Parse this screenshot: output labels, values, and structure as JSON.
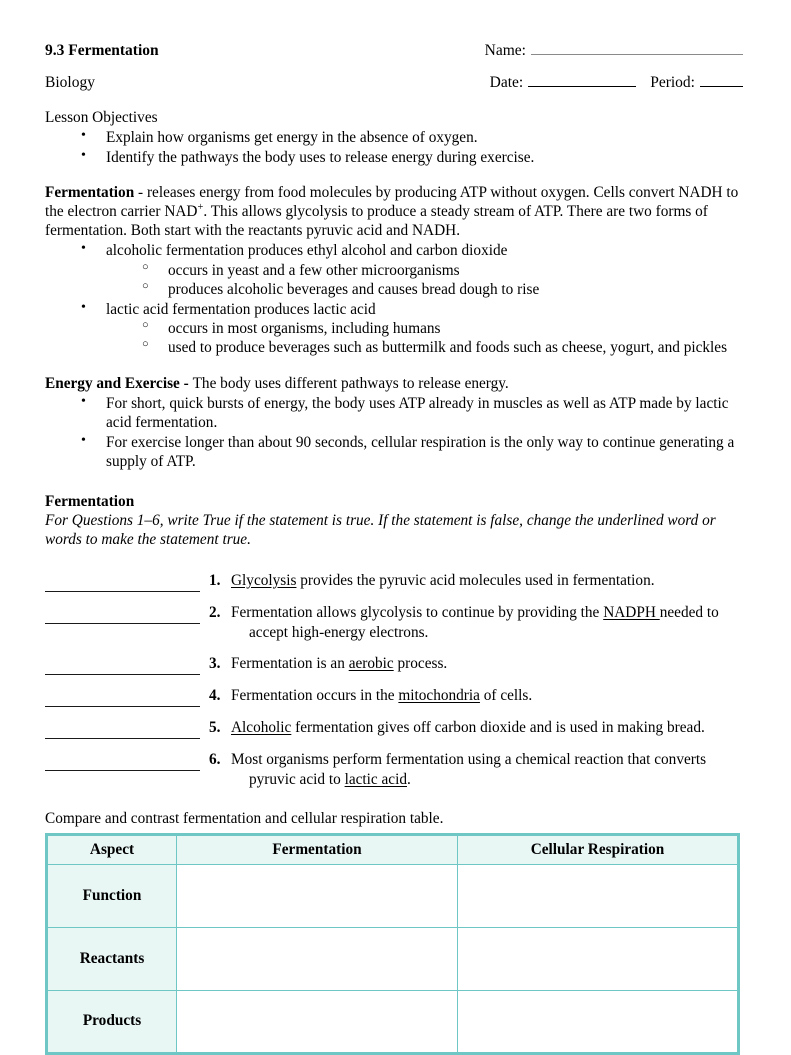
{
  "header": {
    "title": "9.3 Fermentation",
    "subject": "Biology",
    "name_label": "Name:",
    "date_label": "Date:",
    "period_label": "Period:"
  },
  "objectives": {
    "heading": "Lesson Objectives",
    "items": [
      "Explain how organisms get energy in the absence of oxygen.",
      "Identify the pathways the body uses to release energy during exercise."
    ]
  },
  "fermentation_section": {
    "term": "Fermentation",
    "definition_part1": " - releases energy from food molecules by producing ATP without oxygen. Cells convert NADH to the electron carrier NAD",
    "superscript": "+",
    "definition_part2": ". This allows glycolysis to produce a steady stream of ATP. There are two forms of fermentation. Both start with the reactants pyruvic acid and NADH.",
    "types": [
      {
        "label": "alcoholic fermentation produces ethyl alcohol and carbon dioxide",
        "subitems": [
          "occurs in yeast and a few other microorganisms",
          "produces alcoholic beverages and causes bread dough to rise"
        ]
      },
      {
        "label": "lactic acid fermentation produces lactic acid",
        "subitems": [
          "occurs in most organisms, including humans",
          "used to produce beverages such as buttermilk and foods such as cheese, yogurt, and pickles"
        ]
      }
    ]
  },
  "energy_section": {
    "term": "Energy and Exercise - ",
    "intro": "The body uses different pathways to release energy.",
    "items": [
      "For short, quick bursts of energy, the body uses ATP already in muscles as well as ATP made by lactic acid fermentation.",
      "For exercise longer than about 90 seconds, cellular respiration is the only way to continue generating a supply of ATP."
    ]
  },
  "questions_section": {
    "heading": "Fermentation",
    "instructions": "For Questions 1–6, write True if the statement is true. If the statement is false, change the underlined word or words to make the statement true.",
    "items": [
      {
        "number": "1.",
        "pre": "",
        "underlined": "Glycolysis",
        "post": " provides the pyruvic acid molecules used in fermentation.",
        "continuation": ""
      },
      {
        "number": "2.",
        "pre": "Fermentation allows glycolysis to continue by providing the ",
        "underlined": "NADPH ",
        "post": "needed to",
        "continuation": "accept high-energy electrons."
      },
      {
        "number": "3.",
        "pre": "Fermentation is an ",
        "underlined": "aerobic",
        "post": " process.",
        "continuation": ""
      },
      {
        "number": "4.",
        "pre": "Fermentation occurs in the ",
        "underlined": "mitochondria",
        "post": " of cells.",
        "continuation": ""
      },
      {
        "number": "5.",
        "pre": "",
        "underlined": "Alcoholic",
        "post": " fermentation gives off carbon dioxide and is used in making bread.",
        "continuation": ""
      },
      {
        "number": "6.",
        "pre": "Most organisms perform fermentation using a chemical reaction that converts",
        "underlined": "",
        "post": "",
        "continuation_pre": "pyruvic acid to ",
        "continuation_underlined": "lactic acid",
        "continuation_post": "."
      }
    ]
  },
  "table_section": {
    "intro": "Compare and contrast fermentation and cellular respiration table.",
    "columns": [
      "Aspect",
      "Fermentation",
      "Cellular Respiration"
    ],
    "rows": [
      {
        "aspect": "Function",
        "fermentation": "",
        "cellular_respiration": ""
      },
      {
        "aspect": "Reactants",
        "fermentation": "",
        "cellular_respiration": ""
      },
      {
        "aspect": "Products",
        "fermentation": "",
        "cellular_respiration": ""
      }
    ]
  },
  "colors": {
    "table_border": "#6ec7c4",
    "table_header_fill": "#e8f6f4",
    "text": "#000000",
    "page_background": "#ffffff"
  }
}
